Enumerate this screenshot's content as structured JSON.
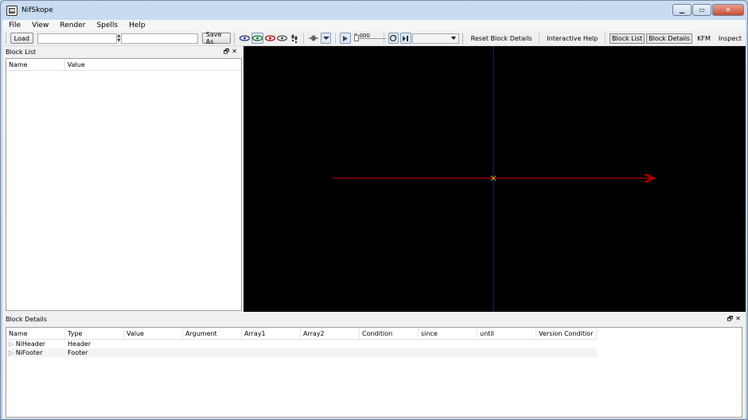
{
  "window": {
    "title": "NifSkope"
  },
  "menu": [
    "File",
    "View",
    "Render",
    "Spells",
    "Help"
  ],
  "toolbar": {
    "load_label": "Load",
    "save_as_label": "Save As",
    "time_value": "0.000",
    "links": [
      "Reset Block Details",
      "Interactive Help"
    ],
    "toggles": [
      "Block List",
      "Block Details"
    ],
    "extra": [
      "KFM",
      "Inspect"
    ]
  },
  "block_list": {
    "title": "Block List",
    "columns": [
      "Name",
      "Value"
    ]
  },
  "block_details": {
    "title": "Block Details",
    "columns": [
      "Name",
      "Type",
      "Value",
      "Argument",
      "Array1",
      "Array2",
      "Condition",
      "since",
      "until",
      "Version Conditior"
    ],
    "rows": [
      {
        "name": "NiHeader",
        "type": "Header"
      },
      {
        "name": "NiFooter",
        "type": "Footer"
      }
    ]
  },
  "colors": {
    "x_axis": "#d40000",
    "y_axis": "#1a1acc",
    "viewport_bg": "#000000"
  }
}
